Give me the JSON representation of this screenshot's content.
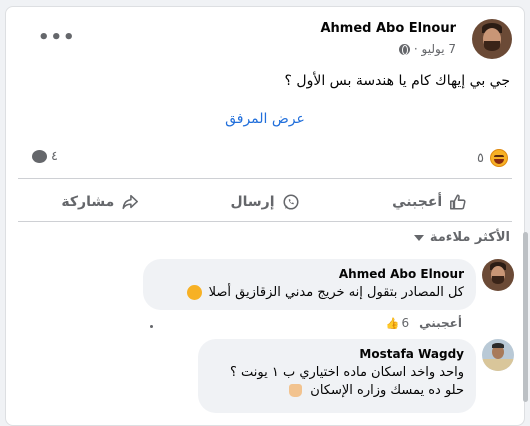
{
  "post": {
    "author": "Ahmed Abo Elnour",
    "date": "7 يوليو ·",
    "text": "جي بي إيهاك كام يا هندسة بس الأول ؟",
    "attachment_link": "عرض المرفق",
    "reaction_count": "٥",
    "comment_count": "٤",
    "reaction_icon": "haha-emoji-icon"
  },
  "actions": {
    "like": "أعجبني",
    "send": "إرسال",
    "share": "مشاركة"
  },
  "sort": {
    "label": "الأكثر ملاءمة"
  },
  "comments": [
    {
      "author": "Ahmed Abo Elnour",
      "text": "كل المصادر بتقول إنه خريج مدني الزقازيق أصلا",
      "like_label": "أعجبني",
      "like_count": "6"
    },
    {
      "author": "Mostafa Wagdy",
      "line1": "واحد واخد اسكان ماده اختياري ب ١ يونت ؟",
      "line2": "حلو ده يمسك وزاره الإسكان"
    }
  ],
  "colors": {
    "link": "#216fdb",
    "muted": "#65676b",
    "bubble": "#f0f2f5"
  }
}
